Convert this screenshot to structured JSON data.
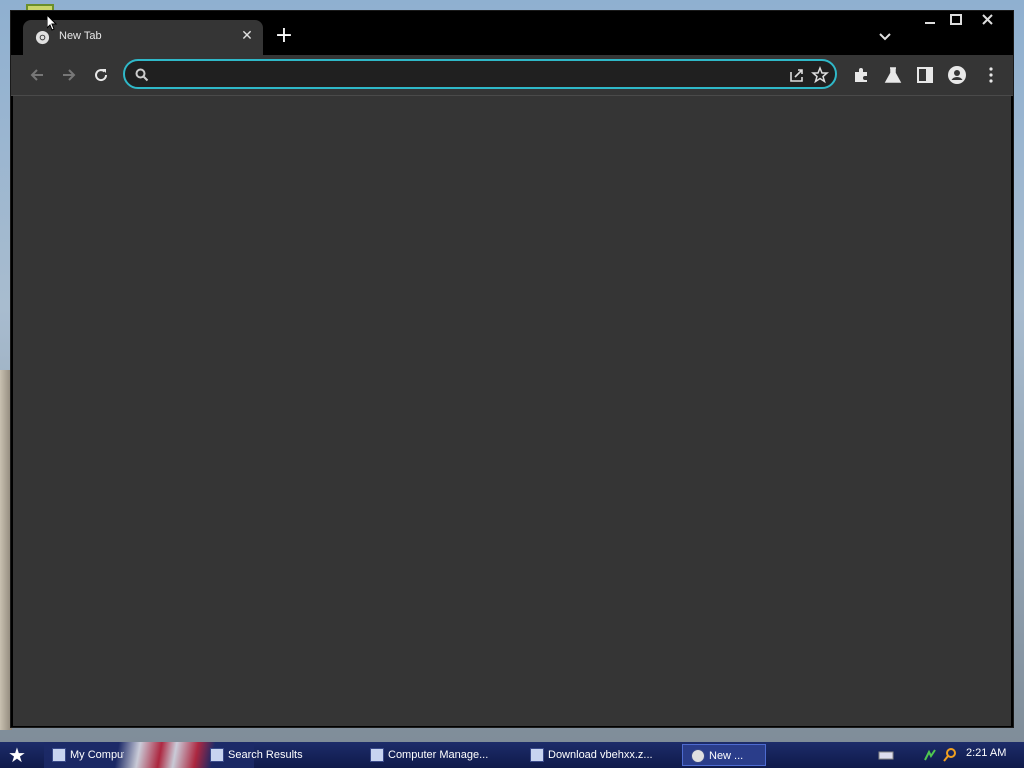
{
  "browser": {
    "tab": {
      "title": "New Tab",
      "close_glyph": "✕"
    },
    "new_tab_glyph": "+",
    "omnibox": {
      "value": "",
      "placeholder": ""
    },
    "colors": {
      "frame": "#000000",
      "toolbar": "#353535",
      "content": "#353535",
      "omnibox_border": "#2fb8c8"
    }
  },
  "window_controls": {
    "minimize_glyph": "—",
    "maximize_glyph": "☐",
    "close_glyph": "✕"
  },
  "taskbar": {
    "items": [
      {
        "label": "My Comput..."
      },
      {
        "label": "Search Results"
      },
      {
        "label": "Computer Manage..."
      },
      {
        "label": "Download vbehxx.z..."
      },
      {
        "label": "New ..."
      }
    ],
    "clock": "2:21 AM"
  }
}
